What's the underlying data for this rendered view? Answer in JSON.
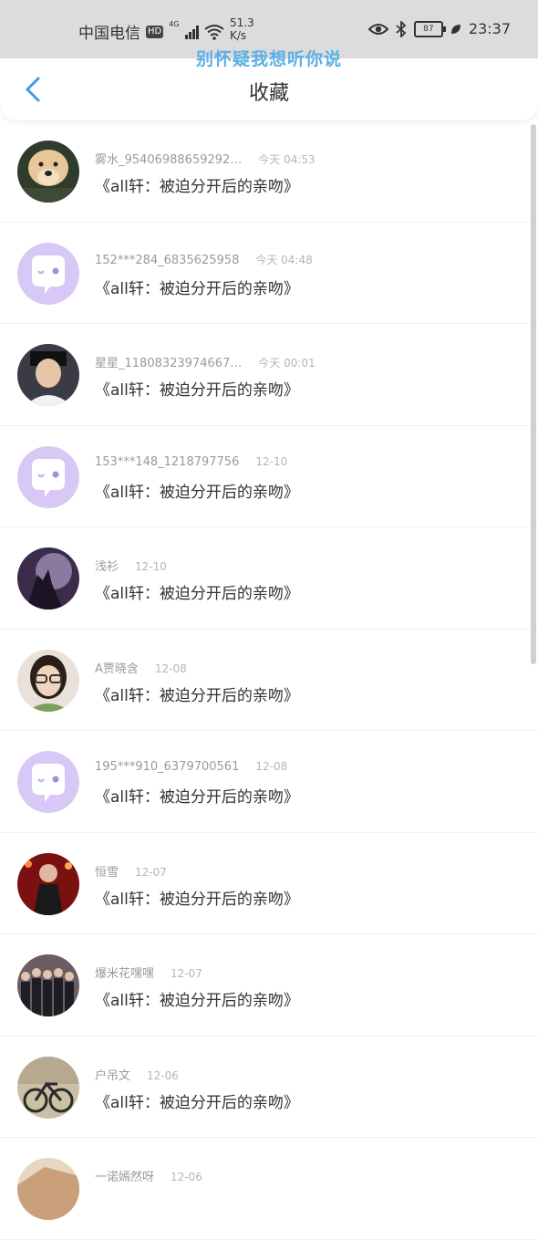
{
  "status_bar": {
    "carrier": "中国电信",
    "hd": "HD",
    "network": "4G",
    "speed_value": "51.3",
    "speed_unit": "K/s",
    "battery": "87",
    "time": "23:37"
  },
  "overlay_text": "别怀疑我想听你说",
  "header": {
    "title": "收藏",
    "back_icon": "chevron-left-icon"
  },
  "colors": {
    "accent": "#3d9be9",
    "default_avatar_bg": "#d8c8f5",
    "default_avatar_fg": "#ffffff"
  },
  "items": [
    {
      "name": "雾水_95406988659292…",
      "time": "今天 04:53",
      "title": "《all轩：被迫分开后的亲吻》",
      "avatar": "photo-dog"
    },
    {
      "name": "152***284_6835625958",
      "time": "今天 04:48",
      "title": "《all轩：被迫分开后的亲吻》",
      "avatar": "default"
    },
    {
      "name": "星星_11808323974667…",
      "time": "今天 00:01",
      "title": "《all轩：被迫分开后的亲吻》",
      "avatar": "photo-person"
    },
    {
      "name": "153***148_1218797756",
      "time": "12-10",
      "title": "《all轩：被迫分开后的亲吻》",
      "avatar": "default"
    },
    {
      "name": "浅衫",
      "time": "12-10",
      "title": "《all轩：被迫分开后的亲吻》",
      "avatar": "photo-moon"
    },
    {
      "name": "A贾晓含",
      "time": "12-08",
      "title": "《all轩：被迫分开后的亲吻》",
      "avatar": "photo-girl"
    },
    {
      "name": "195***910_6379700561",
      "time": "12-08",
      "title": "《all轩：被迫分开后的亲吻》",
      "avatar": "default"
    },
    {
      "name": "恒雪",
      "time": "12-07",
      "title": "《all轩：被迫分开后的亲吻》",
      "avatar": "photo-stage"
    },
    {
      "name": "爆米花嘿嘿",
      "time": "12-07",
      "title": "《all轩：被迫分开后的亲吻》",
      "avatar": "photo-group"
    },
    {
      "name": "户吊文",
      "time": "12-06",
      "title": "《all轩：被迫分开后的亲吻》",
      "avatar": "photo-bike"
    },
    {
      "name": "一诺嫣然呀",
      "time": "12-06",
      "title": "",
      "avatar": "photo-partial"
    }
  ]
}
